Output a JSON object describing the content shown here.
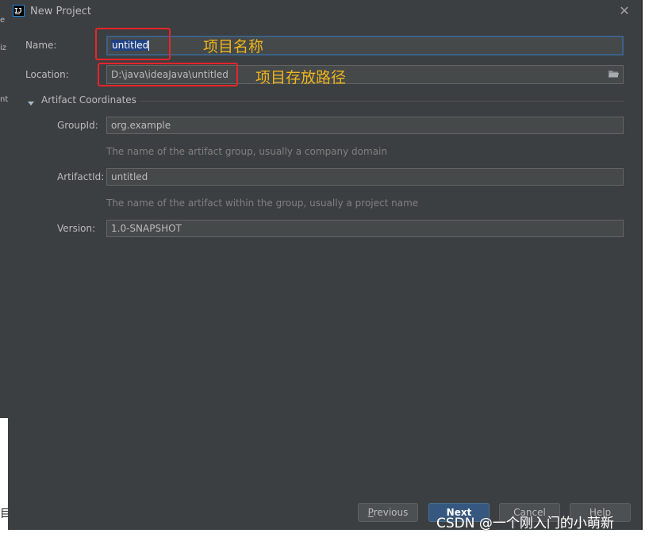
{
  "window": {
    "title": "New Project",
    "app_icon": "intellij-icon",
    "close_icon": "close-icon"
  },
  "background": {
    "fragments": [
      "e",
      "iz",
      "nt"
    ],
    "white_fragments": [
      "目"
    ]
  },
  "form": {
    "name_label": "Name:",
    "name_value": "untitled",
    "location_label": "Location:",
    "location_value": "D:\\java\\ideaJava\\untitled",
    "browse_icon": "folder-icon"
  },
  "artifact": {
    "section_title": "Artifact Coordinates",
    "expanded": true,
    "group_label": "GroupId:",
    "group_value": "org.example",
    "group_hint": "The name of the artifact group, usually a company domain",
    "artifact_label": "ArtifactId:",
    "artifact_value": "untitled",
    "artifact_hint": "The name of the artifact within the group, usually a project name",
    "version_label": "Version:",
    "version_value": "1.0-SNAPSHOT"
  },
  "buttons": {
    "previous_mnemonic": "P",
    "previous_rest": "revious",
    "next": "Next",
    "cancel": "Cancel",
    "help": "Help"
  },
  "annotations": {
    "name_note": "项目名称",
    "location_note": "项目存放路径"
  },
  "watermark": "CSDN @一个刚入门的小萌新",
  "colors": {
    "accent": "#365880",
    "annotation_box": "#e8242a",
    "annotation_text": "#f0b51a",
    "selection": "#214283"
  }
}
